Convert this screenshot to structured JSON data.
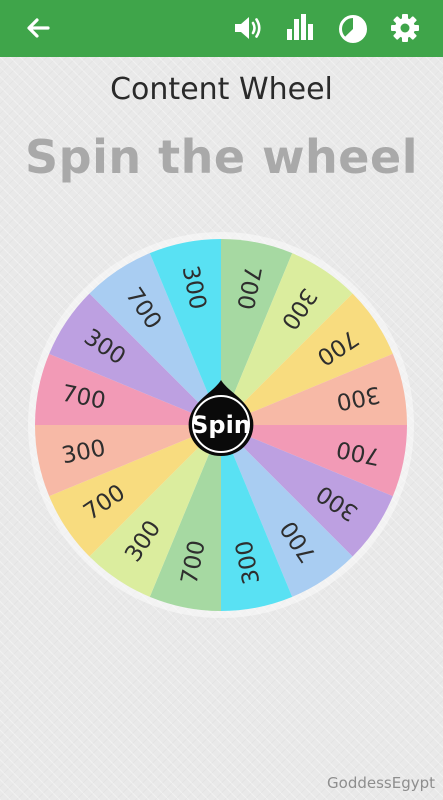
{
  "app": {
    "accent": "#3fa54a"
  },
  "toolbar": {
    "back_icon": "back-arrow-icon",
    "sound_icon": "sound-icon",
    "stats_icon": "bar-chart-icon",
    "pie_icon": "pie-chart-icon",
    "settings_icon": "gear-icon"
  },
  "header": {
    "title": "Content Wheel",
    "subtitle": "Spin the wheel"
  },
  "wheel": {
    "spin_label": "Spin",
    "segments": [
      {
        "label": "700",
        "color": "#a6d9a2"
      },
      {
        "label": "300",
        "color": "#dbed9e"
      },
      {
        "label": "700",
        "color": "#f8dc7f"
      },
      {
        "label": "300",
        "color": "#f7b9a6"
      },
      {
        "label": "700",
        "color": "#f29ab6"
      },
      {
        "label": "300",
        "color": "#bda0e1"
      },
      {
        "label": "700",
        "color": "#a9cdf2"
      },
      {
        "label": "300",
        "color": "#59e1f3"
      },
      {
        "label": "700",
        "color": "#a6d9a2"
      },
      {
        "label": "300",
        "color": "#dbed9e"
      },
      {
        "label": "700",
        "color": "#f8dc7f"
      },
      {
        "label": "300",
        "color": "#f7b9a6"
      },
      {
        "label": "700",
        "color": "#f29ab6"
      },
      {
        "label": "300",
        "color": "#bda0e1"
      },
      {
        "label": "700",
        "color": "#a9cdf2"
      },
      {
        "label": "300",
        "color": "#59e1f3"
      }
    ]
  },
  "watermark": "GoddessEgypt"
}
